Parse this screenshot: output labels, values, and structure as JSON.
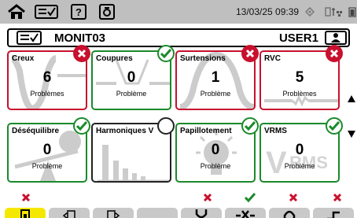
{
  "header": {
    "datetime": "13/03/25 09:39"
  },
  "titlebar": {
    "title": "MONIT03",
    "user": "USER1"
  },
  "cards": [
    {
      "title": "Creux",
      "value": "6",
      "label": "Problèmes",
      "status": "error"
    },
    {
      "title": "Coupures",
      "value": "0",
      "label": "Problème",
      "status": "ok"
    },
    {
      "title": "Surtensions",
      "value": "1",
      "label": "Problème",
      "status": "error"
    },
    {
      "title": "RVC",
      "value": "5",
      "label": "Problèmes",
      "status": "error"
    },
    {
      "title": "Déséquilibre",
      "value": "0",
      "label": "Problème",
      "status": "ok"
    },
    {
      "title": "Harmoniques V",
      "value": "",
      "label": "",
      "status": "none"
    },
    {
      "title": "Papillotement",
      "value": "0",
      "label": "Problème",
      "status": "ok"
    },
    {
      "title": "VRMS",
      "value": "0",
      "label": "Problème",
      "status": "ok"
    }
  ],
  "bottom_marks": [
    "error",
    "ok",
    "error",
    "error"
  ],
  "colors": {
    "error": "#c8102e",
    "ok": "#1b8a2a",
    "topbar": "#bfbfbf",
    "active_tab": "#f5e800"
  },
  "icons": [
    "home-icon",
    "checklist-icon",
    "help-icon",
    "camera-icon",
    "gps-icon",
    "battery-icon",
    "user-icon",
    "arrow-up-icon",
    "arrow-down-icon"
  ]
}
